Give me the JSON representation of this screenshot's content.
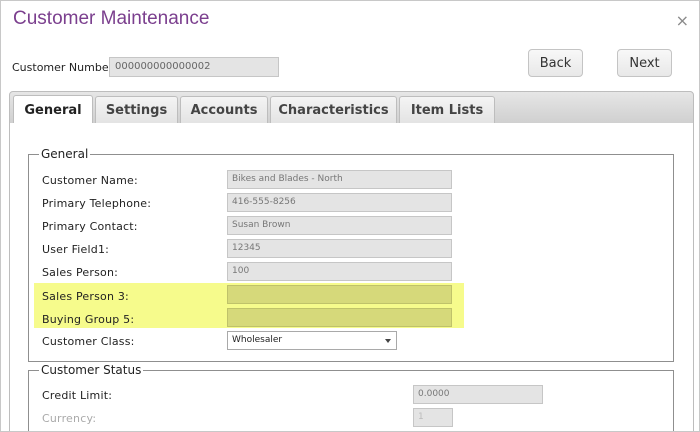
{
  "window": {
    "title": "Customer Maintenance",
    "close": "×"
  },
  "header": {
    "customer_number_label": "Customer Number:",
    "customer_number_value": "000000000000002",
    "back_label": "Back",
    "next_label": "Next"
  },
  "tabs": [
    {
      "label": "General"
    },
    {
      "label": "Settings"
    },
    {
      "label": "Accounts"
    },
    {
      "label": "Characteristics"
    },
    {
      "label": "Item Lists"
    }
  ],
  "general": {
    "legend": "General",
    "customer_name_label": "Customer Name:",
    "customer_name_value": "Bikes and Blades - North",
    "primary_telephone_label": "Primary Telephone:",
    "primary_telephone_value": "416-555-8256",
    "primary_contact_label": "Primary Contact:",
    "primary_contact_value": "Susan Brown",
    "user_field1_label": "User Field1:",
    "user_field1_value": "12345",
    "sales_person_label": "Sales Person:",
    "sales_person_value": "100",
    "sales_person3_label": "Sales Person 3:",
    "sales_person3_value": "",
    "buying_group5_label": "Buying Group 5:",
    "buying_group5_value": "",
    "customer_class_label": "Customer Class:",
    "customer_class_value": "Wholesaler"
  },
  "status": {
    "legend": "Customer Status",
    "credit_limit_label": "Credit Limit:",
    "credit_limit_value": "0.0000",
    "currency_label": "Currency:",
    "currency_value": "1"
  },
  "colors": {
    "title": "#7b3f8e",
    "highlight": "#f6fb8c",
    "highlight_field": "#d6d97a"
  }
}
